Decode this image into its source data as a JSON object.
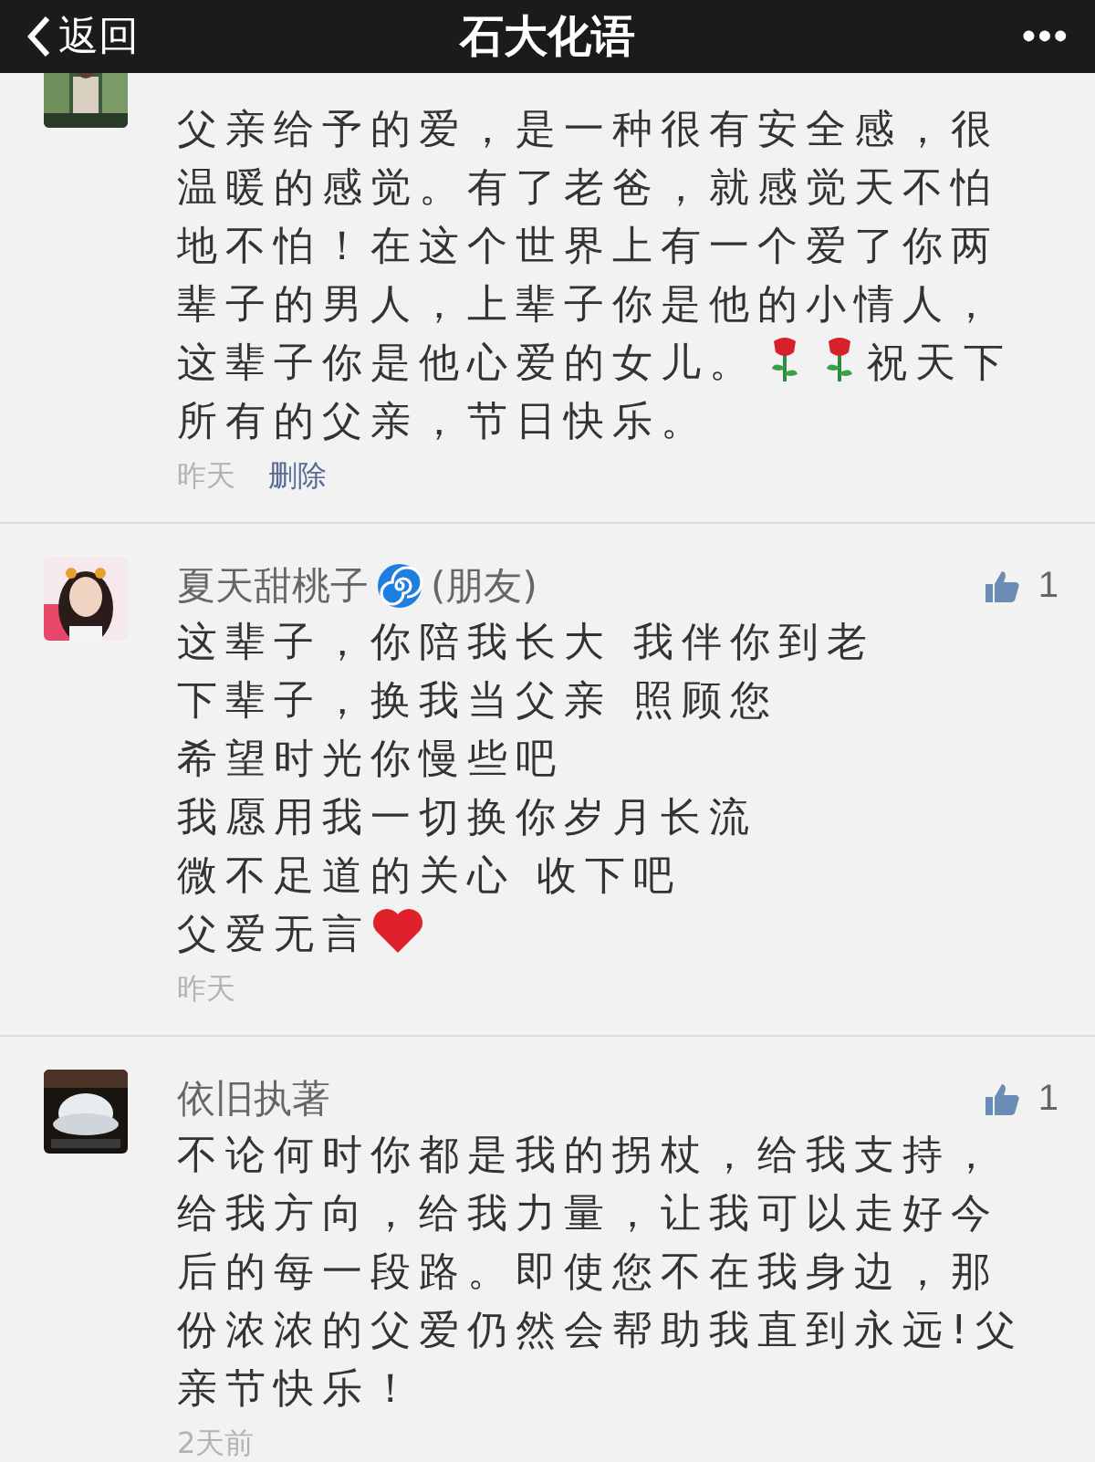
{
  "header": {
    "back": "返回",
    "title": "石大化语",
    "more": "•••"
  },
  "comments": [
    {
      "lines": [
        [
          {
            "kind": "text",
            "text": "父亲给予的爱，是一种很有安全感，很"
          }
        ],
        [
          {
            "kind": "text",
            "text": "温暖的感觉。有了老爸，就感觉天不怕"
          }
        ],
        [
          {
            "kind": "text",
            "text": "地不怕！在这个世界上有一个爱了你两"
          }
        ],
        [
          {
            "kind": "text",
            "text": "辈子的男人，上辈子你是他的小情人，"
          }
        ],
        [
          {
            "kind": "text",
            "text": "这辈子你是他心爱的女儿。"
          },
          {
            "kind": "rose"
          },
          {
            "kind": "rose"
          },
          {
            "kind": "text",
            "text": "祝天下"
          }
        ],
        [
          {
            "kind": "text",
            "text": "所有的父亲，节日快乐。"
          }
        ]
      ],
      "time": "昨天",
      "delete": "删除"
    },
    {
      "name": "夏天甜桃子",
      "badge": {
        "kind": "spiral"
      },
      "tag": "(朋友)",
      "likes": "1",
      "lines": [
        [
          {
            "kind": "text",
            "text": "这辈子，你陪我长大 我伴你到老"
          }
        ],
        [
          {
            "kind": "text",
            "text": "下辈子，换我当父亲 照顾您"
          }
        ],
        [
          {
            "kind": "text",
            "text": "希望时光你慢些吧"
          }
        ],
        [
          {
            "kind": "text",
            "text": "我愿用我一切换你岁月长流"
          }
        ],
        [
          {
            "kind": "text",
            "text": "微不足道的关心 收下吧"
          }
        ],
        [
          {
            "kind": "text",
            "text": "父爱无言"
          },
          {
            "kind": "heart"
          }
        ]
      ],
      "time": "昨天"
    },
    {
      "name": "依旧执著",
      "likes": "1",
      "lines": [
        [
          {
            "kind": "text",
            "text": "不论何时你都是我的拐杖，给我支持，"
          }
        ],
        [
          {
            "kind": "text",
            "text": "给我方向，给我力量，让我可以走好今"
          }
        ],
        [
          {
            "kind": "text",
            "text": "后的每一段路。即使您不在我身边，那"
          }
        ],
        [
          {
            "kind": "text",
            "text": "份浓浓的父爱仍然会帮助我直到永远!父"
          }
        ],
        [
          {
            "kind": "text",
            "text": "亲节快乐！"
          }
        ]
      ],
      "time": "2天前"
    }
  ]
}
